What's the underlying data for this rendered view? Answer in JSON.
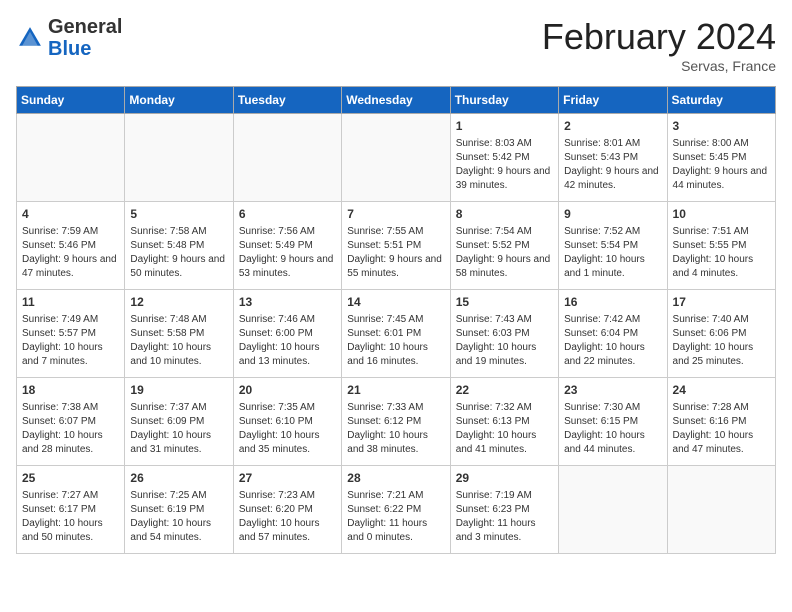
{
  "header": {
    "logo_general": "General",
    "logo_blue": "Blue",
    "month_title": "February 2024",
    "location": "Servas, France"
  },
  "days_of_week": [
    "Sunday",
    "Monday",
    "Tuesday",
    "Wednesday",
    "Thursday",
    "Friday",
    "Saturday"
  ],
  "weeks": [
    [
      {
        "day": "",
        "sunrise": "",
        "sunset": "",
        "daylight": "",
        "empty": true
      },
      {
        "day": "",
        "sunrise": "",
        "sunset": "",
        "daylight": "",
        "empty": true
      },
      {
        "day": "",
        "sunrise": "",
        "sunset": "",
        "daylight": "",
        "empty": true
      },
      {
        "day": "",
        "sunrise": "",
        "sunset": "",
        "daylight": "",
        "empty": true
      },
      {
        "day": "1",
        "sunrise": "Sunrise: 8:03 AM",
        "sunset": "Sunset: 5:42 PM",
        "daylight": "Daylight: 9 hours and 39 minutes.",
        "empty": false
      },
      {
        "day": "2",
        "sunrise": "Sunrise: 8:01 AM",
        "sunset": "Sunset: 5:43 PM",
        "daylight": "Daylight: 9 hours and 42 minutes.",
        "empty": false
      },
      {
        "day": "3",
        "sunrise": "Sunrise: 8:00 AM",
        "sunset": "Sunset: 5:45 PM",
        "daylight": "Daylight: 9 hours and 44 minutes.",
        "empty": false
      }
    ],
    [
      {
        "day": "4",
        "sunrise": "Sunrise: 7:59 AM",
        "sunset": "Sunset: 5:46 PM",
        "daylight": "Daylight: 9 hours and 47 minutes.",
        "empty": false
      },
      {
        "day": "5",
        "sunrise": "Sunrise: 7:58 AM",
        "sunset": "Sunset: 5:48 PM",
        "daylight": "Daylight: 9 hours and 50 minutes.",
        "empty": false
      },
      {
        "day": "6",
        "sunrise": "Sunrise: 7:56 AM",
        "sunset": "Sunset: 5:49 PM",
        "daylight": "Daylight: 9 hours and 53 minutes.",
        "empty": false
      },
      {
        "day": "7",
        "sunrise": "Sunrise: 7:55 AM",
        "sunset": "Sunset: 5:51 PM",
        "daylight": "Daylight: 9 hours and 55 minutes.",
        "empty": false
      },
      {
        "day": "8",
        "sunrise": "Sunrise: 7:54 AM",
        "sunset": "Sunset: 5:52 PM",
        "daylight": "Daylight: 9 hours and 58 minutes.",
        "empty": false
      },
      {
        "day": "9",
        "sunrise": "Sunrise: 7:52 AM",
        "sunset": "Sunset: 5:54 PM",
        "daylight": "Daylight: 10 hours and 1 minute.",
        "empty": false
      },
      {
        "day": "10",
        "sunrise": "Sunrise: 7:51 AM",
        "sunset": "Sunset: 5:55 PM",
        "daylight": "Daylight: 10 hours and 4 minutes.",
        "empty": false
      }
    ],
    [
      {
        "day": "11",
        "sunrise": "Sunrise: 7:49 AM",
        "sunset": "Sunset: 5:57 PM",
        "daylight": "Daylight: 10 hours and 7 minutes.",
        "empty": false
      },
      {
        "day": "12",
        "sunrise": "Sunrise: 7:48 AM",
        "sunset": "Sunset: 5:58 PM",
        "daylight": "Daylight: 10 hours and 10 minutes.",
        "empty": false
      },
      {
        "day": "13",
        "sunrise": "Sunrise: 7:46 AM",
        "sunset": "Sunset: 6:00 PM",
        "daylight": "Daylight: 10 hours and 13 minutes.",
        "empty": false
      },
      {
        "day": "14",
        "sunrise": "Sunrise: 7:45 AM",
        "sunset": "Sunset: 6:01 PM",
        "daylight": "Daylight: 10 hours and 16 minutes.",
        "empty": false
      },
      {
        "day": "15",
        "sunrise": "Sunrise: 7:43 AM",
        "sunset": "Sunset: 6:03 PM",
        "daylight": "Daylight: 10 hours and 19 minutes.",
        "empty": false
      },
      {
        "day": "16",
        "sunrise": "Sunrise: 7:42 AM",
        "sunset": "Sunset: 6:04 PM",
        "daylight": "Daylight: 10 hours and 22 minutes.",
        "empty": false
      },
      {
        "day": "17",
        "sunrise": "Sunrise: 7:40 AM",
        "sunset": "Sunset: 6:06 PM",
        "daylight": "Daylight: 10 hours and 25 minutes.",
        "empty": false
      }
    ],
    [
      {
        "day": "18",
        "sunrise": "Sunrise: 7:38 AM",
        "sunset": "Sunset: 6:07 PM",
        "daylight": "Daylight: 10 hours and 28 minutes.",
        "empty": false
      },
      {
        "day": "19",
        "sunrise": "Sunrise: 7:37 AM",
        "sunset": "Sunset: 6:09 PM",
        "daylight": "Daylight: 10 hours and 31 minutes.",
        "empty": false
      },
      {
        "day": "20",
        "sunrise": "Sunrise: 7:35 AM",
        "sunset": "Sunset: 6:10 PM",
        "daylight": "Daylight: 10 hours and 35 minutes.",
        "empty": false
      },
      {
        "day": "21",
        "sunrise": "Sunrise: 7:33 AM",
        "sunset": "Sunset: 6:12 PM",
        "daylight": "Daylight: 10 hours and 38 minutes.",
        "empty": false
      },
      {
        "day": "22",
        "sunrise": "Sunrise: 7:32 AM",
        "sunset": "Sunset: 6:13 PM",
        "daylight": "Daylight: 10 hours and 41 minutes.",
        "empty": false
      },
      {
        "day": "23",
        "sunrise": "Sunrise: 7:30 AM",
        "sunset": "Sunset: 6:15 PM",
        "daylight": "Daylight: 10 hours and 44 minutes.",
        "empty": false
      },
      {
        "day": "24",
        "sunrise": "Sunrise: 7:28 AM",
        "sunset": "Sunset: 6:16 PM",
        "daylight": "Daylight: 10 hours and 47 minutes.",
        "empty": false
      }
    ],
    [
      {
        "day": "25",
        "sunrise": "Sunrise: 7:27 AM",
        "sunset": "Sunset: 6:17 PM",
        "daylight": "Daylight: 10 hours and 50 minutes.",
        "empty": false
      },
      {
        "day": "26",
        "sunrise": "Sunrise: 7:25 AM",
        "sunset": "Sunset: 6:19 PM",
        "daylight": "Daylight: 10 hours and 54 minutes.",
        "empty": false
      },
      {
        "day": "27",
        "sunrise": "Sunrise: 7:23 AM",
        "sunset": "Sunset: 6:20 PM",
        "daylight": "Daylight: 10 hours and 57 minutes.",
        "empty": false
      },
      {
        "day": "28",
        "sunrise": "Sunrise: 7:21 AM",
        "sunset": "Sunset: 6:22 PM",
        "daylight": "Daylight: 11 hours and 0 minutes.",
        "empty": false
      },
      {
        "day": "29",
        "sunrise": "Sunrise: 7:19 AM",
        "sunset": "Sunset: 6:23 PM",
        "daylight": "Daylight: 11 hours and 3 minutes.",
        "empty": false
      },
      {
        "day": "",
        "sunrise": "",
        "sunset": "",
        "daylight": "",
        "empty": true
      },
      {
        "day": "",
        "sunrise": "",
        "sunset": "",
        "daylight": "",
        "empty": true
      }
    ]
  ]
}
